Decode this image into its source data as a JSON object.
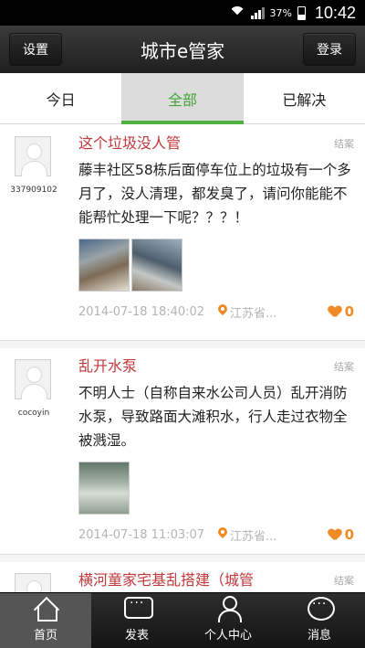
{
  "status_bar": {
    "battery_percent": "37%",
    "time": "10:42",
    "icons": [
      "wifi-icon",
      "signal-icon",
      "battery-icon"
    ]
  },
  "header": {
    "title": "城市e管家",
    "left_button": "设置",
    "right_button": "登录"
  },
  "tabs": [
    {
      "label": "今日",
      "active": false
    },
    {
      "label": "全部",
      "active": true
    },
    {
      "label": "已解决",
      "active": false
    }
  ],
  "colors": {
    "accent_green": "#52b043",
    "title_red": "#c2383a",
    "like_orange": "#f08a24"
  },
  "posts": [
    {
      "username": "337909102",
      "title": "这个垃圾没人管",
      "status": "结案",
      "body": "藤丰社区58栋后面停车位上的垃圾有一个多月了，没人清理，都发臭了，请问你能能不能帮忙处理一下呢？？？！",
      "time": "2014-07-18 18:40:02",
      "location": "江苏省...",
      "likes": "0"
    },
    {
      "username": "cocoyin",
      "title": "乱开水泵",
      "status": "结案",
      "body": "不明人士（自称自来水公司人员）乱开消防水泵，导致路面大滩积水，行人走过衣物全被溅湿。",
      "time": "2014-07-18 11:03:07",
      "location": "江苏省...",
      "likes": "0"
    },
    {
      "username": "",
      "title": "横河童家宅基乱搭建（城管",
      "status": "结案",
      "body": "",
      "time": "",
      "location": "",
      "likes": ""
    }
  ],
  "bottom_nav": [
    {
      "label": "首页",
      "icon": "home-icon",
      "active": true
    },
    {
      "label": "发表",
      "icon": "chat-bubble-icon",
      "active": false
    },
    {
      "label": "个人中心",
      "icon": "user-icon",
      "active": false
    },
    {
      "label": "消息",
      "icon": "message-icon",
      "active": false
    }
  ]
}
